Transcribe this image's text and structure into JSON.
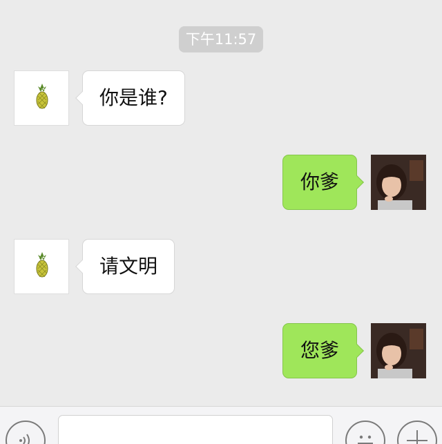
{
  "timestamp": "下午11:57",
  "messages": [
    {
      "side": "left",
      "text": "你是谁?",
      "avatar": "pineapple-avatar"
    },
    {
      "side": "right",
      "text": "你爹",
      "avatar": "girl-photo-avatar"
    },
    {
      "side": "left",
      "text": "请文明",
      "avatar": "pineapple-avatar"
    },
    {
      "side": "right",
      "text": "您爹",
      "avatar": "girl-photo-avatar"
    }
  ],
  "input_bar": {
    "icons": [
      "voice-icon",
      "emoji-icon",
      "plus-icon"
    ]
  },
  "colors": {
    "background": "#ebebeb",
    "sent_bubble": "#9fe65a",
    "received_bubble": "#ffffff",
    "timestamp_bg": "#cfcfcf"
  }
}
